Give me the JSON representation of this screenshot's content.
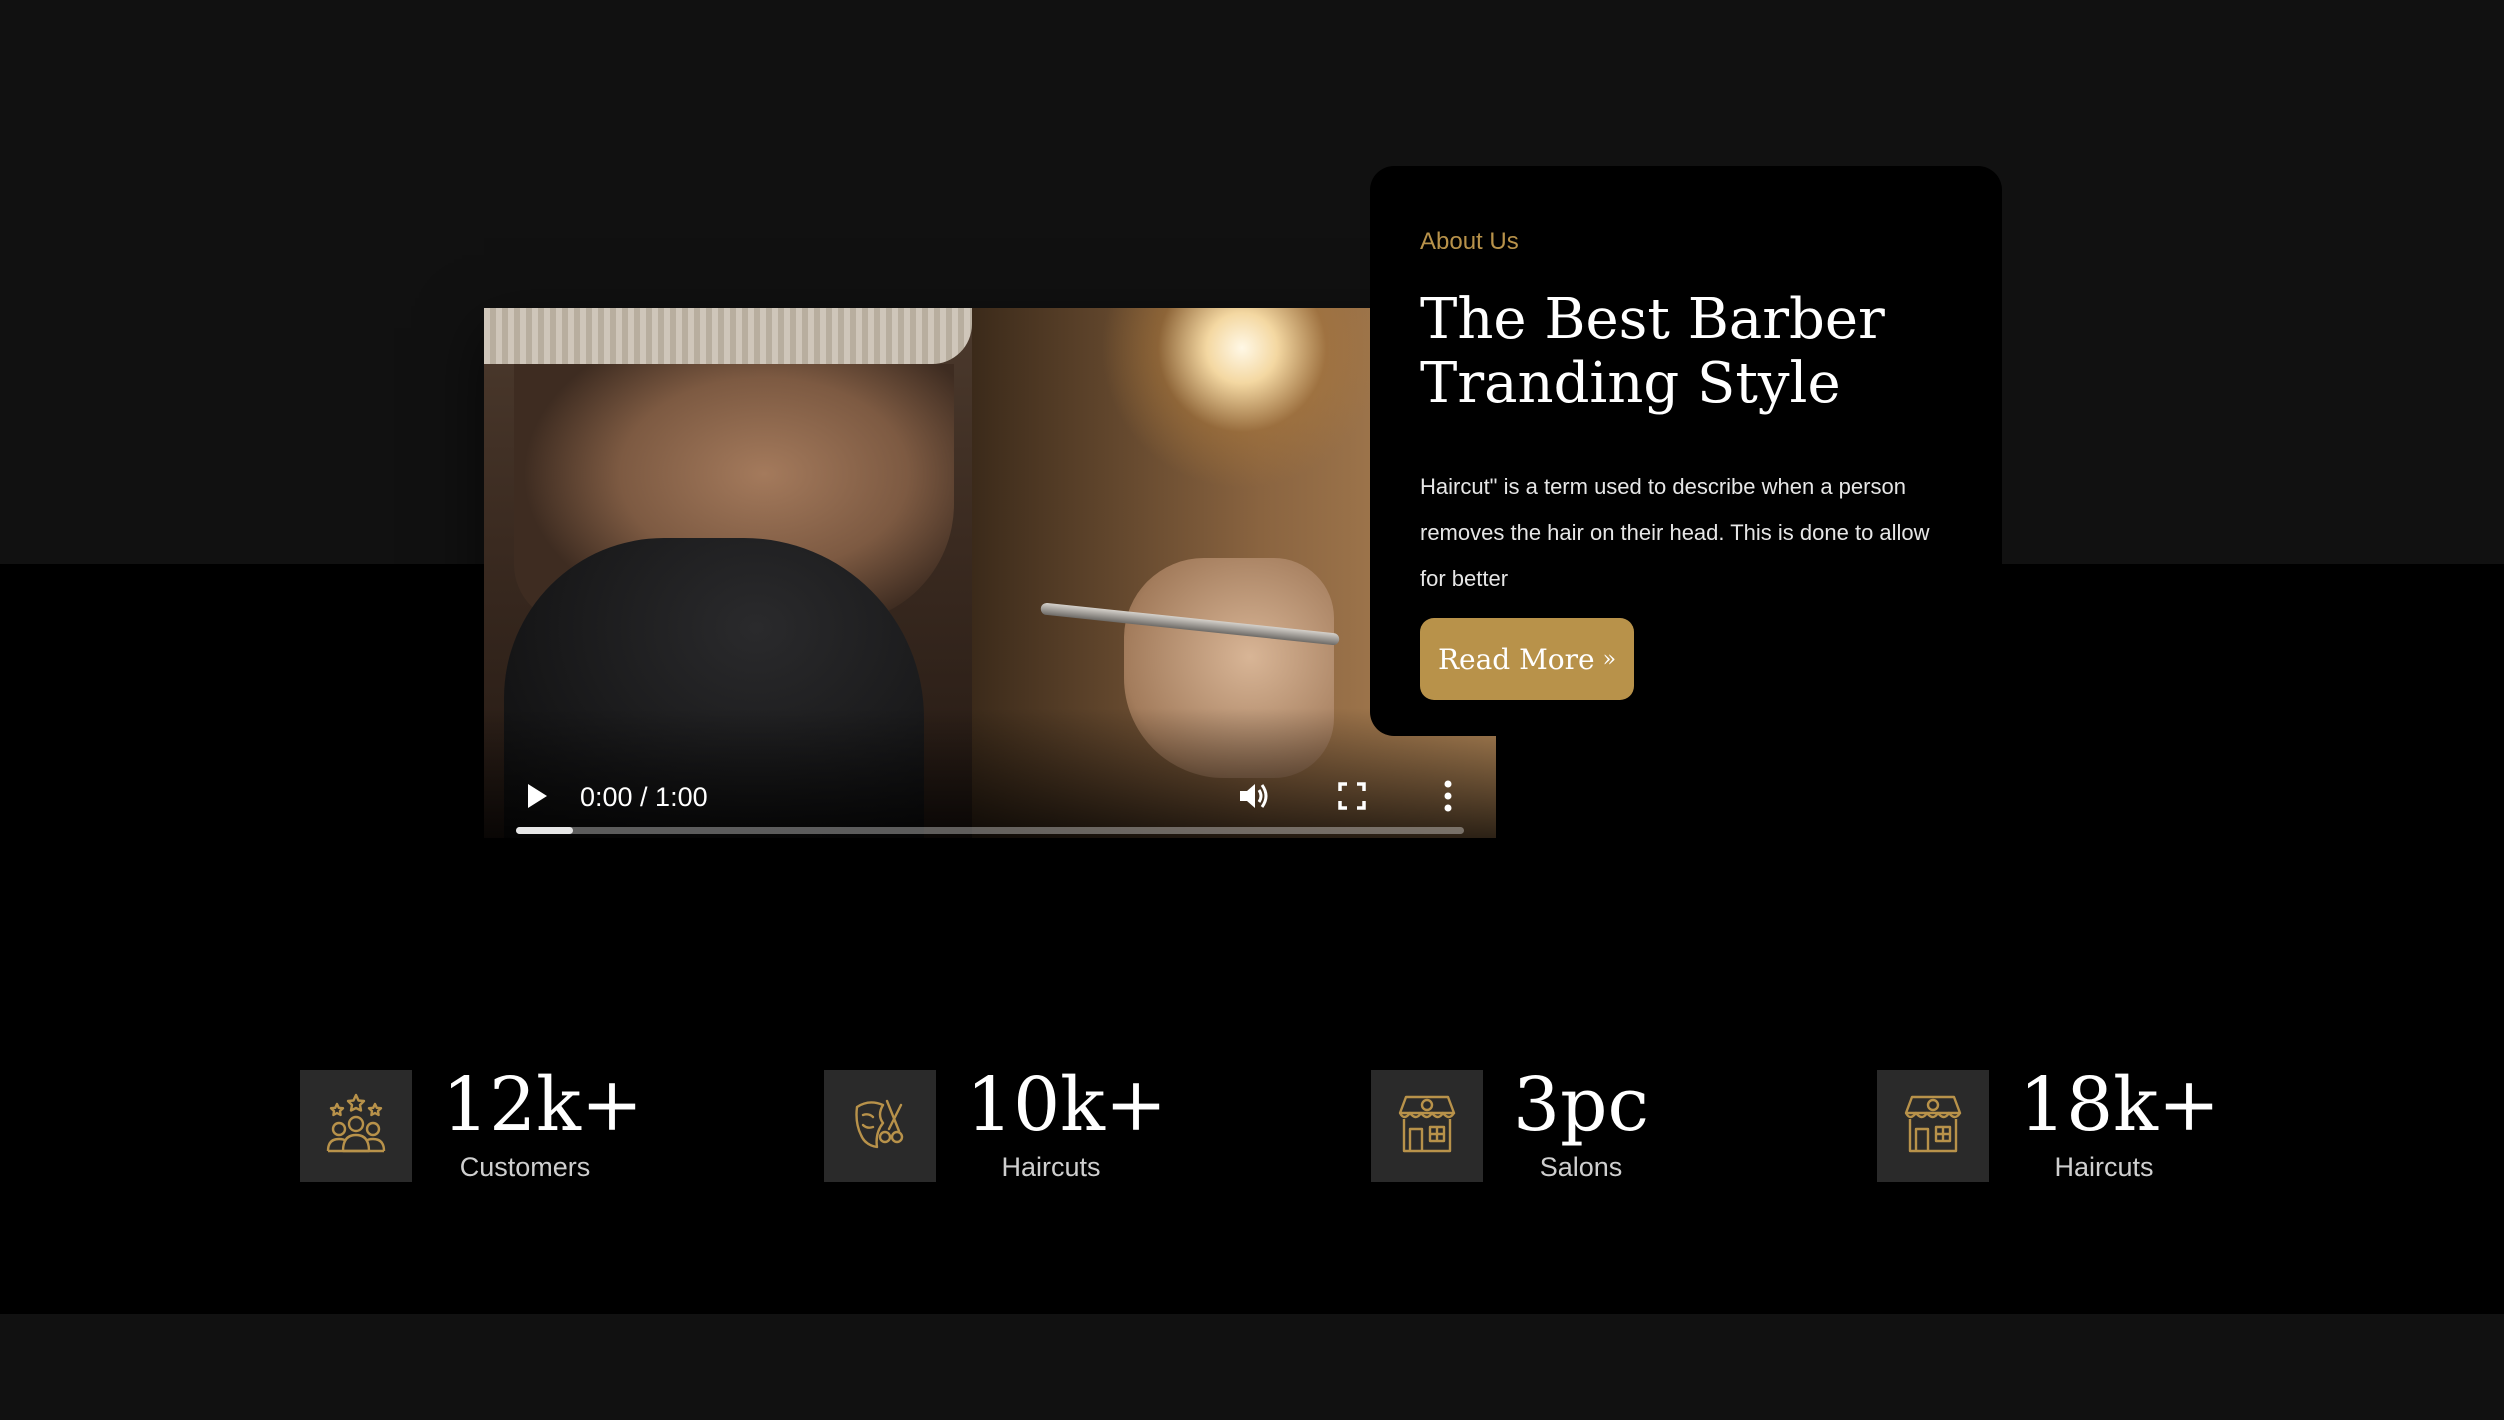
{
  "video": {
    "time": "0:00 / 1:00",
    "progress": 0.06
  },
  "about": {
    "kicker": "About Us",
    "title_line1": "The Best Barber",
    "title_line2": "Tranding Style",
    "text": "Haircut\" is a term used to describe when a person removes the hair on their head. This is done to allow for better",
    "button_label": "Read More",
    "button_icon": "double-chevron-right-icon"
  },
  "stats": [
    {
      "value": "12k+",
      "label": "Customers",
      "icon": "customers-icon"
    },
    {
      "value": "10k+",
      "label": "Haircuts",
      "icon": "haircut-icon"
    },
    {
      "value": "3pc",
      "label": "Salons",
      "icon": "salon-icon"
    },
    {
      "value": "18k+",
      "label": "Haircuts",
      "icon": "salon-icon"
    }
  ],
  "colors": {
    "accent": "#b8924a",
    "background_dark": "#000000",
    "background_band": "#111111",
    "icon_box": "#2a2a2a"
  }
}
